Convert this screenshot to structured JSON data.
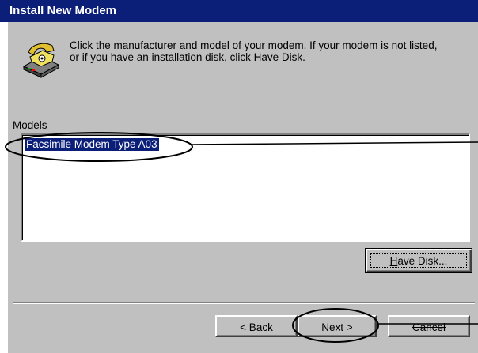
{
  "window": {
    "title": "Install New Modem"
  },
  "instruction": {
    "line1": "Click the manufacturer and model of your modem. If your modem is not listed,",
    "line2": "or if you have an installation disk, click Have Disk."
  },
  "models": {
    "label": "Models",
    "items": [
      "Facsimile Modem Type A03"
    ],
    "selected_index": 0
  },
  "buttons": {
    "have_disk": {
      "prefix": "",
      "underlined": "H",
      "suffix": "ave Disk..."
    },
    "back": {
      "prefix": "< ",
      "underlined": "B",
      "suffix": "ack"
    },
    "next": "Next >",
    "cancel": "Cancel"
  },
  "icons": {
    "modem": "telephone-modem-icon"
  },
  "colors": {
    "title_bar": "#0b1e78",
    "dialog_face": "#c0c0c0",
    "selection": "#0b1e78",
    "annotation": "#000000"
  }
}
